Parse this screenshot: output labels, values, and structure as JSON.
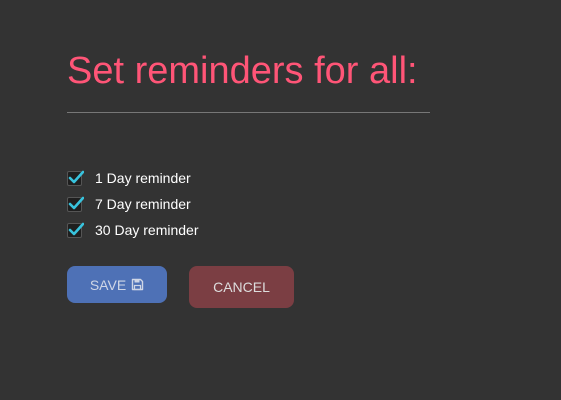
{
  "colors": {
    "background": "#333333",
    "title": "#ff5577",
    "text": "#ffffff",
    "checkmark": "#38c3dd",
    "save_button": "#4e71b6",
    "save_text": "#cfd6e6",
    "cancel_button": "#7b3e43",
    "cancel_text": "#dddddd"
  },
  "title": "Set reminders for all:",
  "options": [
    {
      "label": "1 Day reminder",
      "checked": true
    },
    {
      "label": "7 Day reminder",
      "checked": true
    },
    {
      "label": "30 Day reminder",
      "checked": true
    }
  ],
  "buttons": {
    "save_label": "SAVE",
    "save_icon": "floppy-disk-icon",
    "cancel_label": "CANCEL"
  }
}
